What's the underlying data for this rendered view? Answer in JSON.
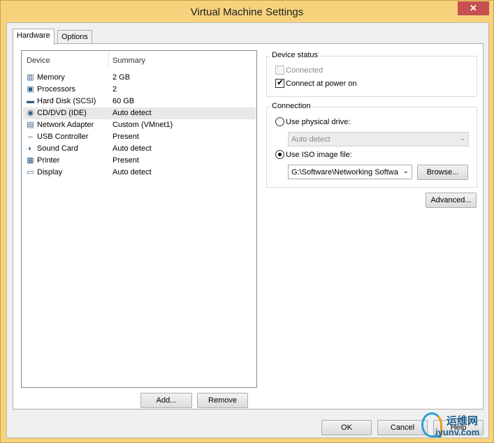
{
  "window": {
    "title": "Virtual Machine Settings",
    "close_glyph": "✕"
  },
  "tabs": [
    {
      "label": "Hardware",
      "active": true
    },
    {
      "label": "Options",
      "active": false
    }
  ],
  "device_list": {
    "columns": {
      "device": "Device",
      "summary": "Summary"
    },
    "rows": [
      {
        "icon": "memory-icon",
        "glyph": "▥",
        "name": "Memory",
        "summary": "2 GB",
        "selected": false
      },
      {
        "icon": "processor-icon",
        "glyph": "▣",
        "name": "Processors",
        "summary": "2",
        "selected": false
      },
      {
        "icon": "hard-disk-icon",
        "glyph": "▬",
        "name": "Hard Disk (SCSI)",
        "summary": "60 GB",
        "selected": false
      },
      {
        "icon": "cd-dvd-icon",
        "glyph": "◉",
        "name": "CD/DVD (IDE)",
        "summary": "Auto detect",
        "selected": true
      },
      {
        "icon": "network-adapter-icon",
        "glyph": "▤",
        "name": "Network Adapter",
        "summary": "Custom (VMnet1)",
        "selected": false
      },
      {
        "icon": "usb-icon",
        "glyph": "⇔",
        "name": "USB Controller",
        "summary": "Present",
        "selected": false
      },
      {
        "icon": "sound-card-icon",
        "glyph": "◐",
        "name": "Sound Card",
        "summary": "Auto detect",
        "selected": false
      },
      {
        "icon": "printer-icon",
        "glyph": "▦",
        "name": "Printer",
        "summary": "Present",
        "selected": false
      },
      {
        "icon": "display-icon",
        "glyph": "▭",
        "name": "Display",
        "summary": "Auto detect",
        "selected": false
      }
    ]
  },
  "list_buttons": {
    "add": "Add...",
    "remove": "Remove"
  },
  "device_status": {
    "title": "Device status",
    "connected": {
      "label": "Connected",
      "checked": false,
      "enabled": false
    },
    "connect_at_power_on": {
      "label": "Connect at power on",
      "checked": true
    }
  },
  "connection": {
    "title": "Connection",
    "use_physical_drive": {
      "label": "Use physical drive:",
      "selected": false
    },
    "physical_drive_select": "Auto detect",
    "use_iso_image": {
      "label": "Use ISO image file:",
      "selected": true
    },
    "iso_path": "G:\\Software\\Networking Softwa",
    "browse": "Browse..."
  },
  "advanced_button": "Advanced...",
  "dialog_buttons": {
    "ok": "OK",
    "cancel": "Cancel",
    "help": "Help"
  },
  "watermark": {
    "cn": "运维网",
    "en": "iyunv.com"
  }
}
